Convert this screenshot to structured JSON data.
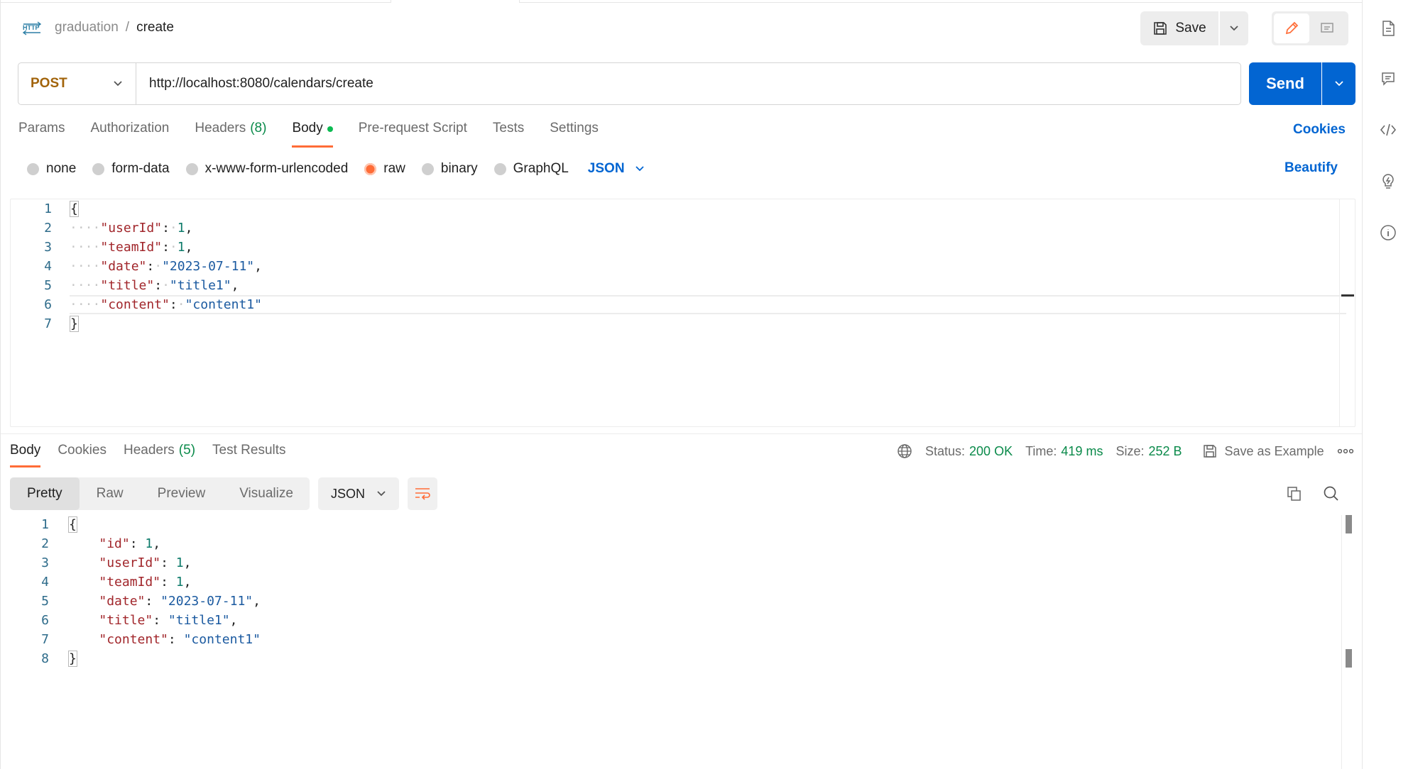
{
  "header": {
    "collection": "graduation",
    "separator": "/",
    "request_name": "create",
    "save_label": "Save"
  },
  "request": {
    "method": "POST",
    "url": "http://localhost:8080/calendars/create",
    "send_label": "Send"
  },
  "request_tabs": [
    {
      "label": "Params"
    },
    {
      "label": "Authorization"
    },
    {
      "label": "Headers",
      "count": "(8)"
    },
    {
      "label": "Body",
      "active": true
    },
    {
      "label": "Pre-request Script"
    },
    {
      "label": "Tests"
    },
    {
      "label": "Settings"
    }
  ],
  "cookies_label": "Cookies",
  "body_types": [
    {
      "label": "none"
    },
    {
      "label": "form-data"
    },
    {
      "label": "x-www-form-urlencoded"
    },
    {
      "label": "raw",
      "checked": true
    },
    {
      "label": "binary"
    },
    {
      "label": "GraphQL"
    }
  ],
  "body_language": "JSON",
  "beautify_label": "Beautify",
  "request_body": {
    "line_numbers": [
      "1",
      "2",
      "3",
      "4",
      "5",
      "6",
      "7"
    ],
    "lines": [
      {
        "parts": [
          {
            "t": "{",
            "c": "brace"
          }
        ]
      },
      {
        "parts": [
          {
            "t": "····",
            "c": "ws"
          },
          {
            "t": "\"userId\"",
            "c": "k"
          },
          {
            "t": ":",
            "c": ""
          },
          {
            "t": "·",
            "c": "ws"
          },
          {
            "t": "1",
            "c": "n"
          },
          {
            "t": ",",
            "c": ""
          }
        ]
      },
      {
        "parts": [
          {
            "t": "····",
            "c": "ws"
          },
          {
            "t": "\"teamId\"",
            "c": "k"
          },
          {
            "t": ":",
            "c": ""
          },
          {
            "t": "·",
            "c": "ws"
          },
          {
            "t": "1",
            "c": "n"
          },
          {
            "t": ",",
            "c": ""
          }
        ]
      },
      {
        "parts": [
          {
            "t": "····",
            "c": "ws"
          },
          {
            "t": "\"date\"",
            "c": "k"
          },
          {
            "t": ":",
            "c": ""
          },
          {
            "t": "·",
            "c": "ws"
          },
          {
            "t": "\"2023-07-11\"",
            "c": "s"
          },
          {
            "t": ",",
            "c": ""
          }
        ]
      },
      {
        "parts": [
          {
            "t": "····",
            "c": "ws"
          },
          {
            "t": "\"title\"",
            "c": "k"
          },
          {
            "t": ":",
            "c": ""
          },
          {
            "t": "·",
            "c": "ws"
          },
          {
            "t": "\"title1\"",
            "c": "s"
          },
          {
            "t": ",",
            "c": ""
          }
        ]
      },
      {
        "parts": [
          {
            "t": "····",
            "c": "ws"
          },
          {
            "t": "\"content\"",
            "c": "k"
          },
          {
            "t": ":",
            "c": ""
          },
          {
            "t": "·",
            "c": "ws"
          },
          {
            "t": "\"content1\"",
            "c": "s"
          }
        ]
      },
      {
        "parts": [
          {
            "t": "}",
            "c": "brace"
          }
        ]
      }
    ]
  },
  "response_tabs": [
    {
      "label": "Body",
      "active": true
    },
    {
      "label": "Cookies"
    },
    {
      "label": "Headers",
      "count": "(5)"
    },
    {
      "label": "Test Results"
    }
  ],
  "response_meta": {
    "status_label": "Status:",
    "status_value": "200 OK",
    "time_label": "Time:",
    "time_value": "419 ms",
    "size_label": "Size:",
    "size_value": "252 B",
    "save_example_label": "Save as Example"
  },
  "response_views": [
    {
      "label": "Pretty",
      "active": true
    },
    {
      "label": "Raw"
    },
    {
      "label": "Preview"
    },
    {
      "label": "Visualize"
    }
  ],
  "response_language": "JSON",
  "response_body": {
    "line_numbers": [
      "1",
      "2",
      "3",
      "4",
      "5",
      "6",
      "7",
      "8"
    ],
    "lines": [
      {
        "parts": [
          {
            "t": "{",
            "c": "brace"
          }
        ]
      },
      {
        "parts": [
          {
            "t": "    ",
            "c": ""
          },
          {
            "t": "\"id\"",
            "c": "k"
          },
          {
            "t": ": ",
            "c": ""
          },
          {
            "t": "1",
            "c": "n"
          },
          {
            "t": ",",
            "c": ""
          }
        ]
      },
      {
        "parts": [
          {
            "t": "    ",
            "c": ""
          },
          {
            "t": "\"userId\"",
            "c": "k"
          },
          {
            "t": ": ",
            "c": ""
          },
          {
            "t": "1",
            "c": "n"
          },
          {
            "t": ",",
            "c": ""
          }
        ]
      },
      {
        "parts": [
          {
            "t": "    ",
            "c": ""
          },
          {
            "t": "\"teamId\"",
            "c": "k"
          },
          {
            "t": ": ",
            "c": ""
          },
          {
            "t": "1",
            "c": "n"
          },
          {
            "t": ",",
            "c": ""
          }
        ]
      },
      {
        "parts": [
          {
            "t": "    ",
            "c": ""
          },
          {
            "t": "\"date\"",
            "c": "k"
          },
          {
            "t": ": ",
            "c": ""
          },
          {
            "t": "\"2023-07-11\"",
            "c": "s"
          },
          {
            "t": ",",
            "c": ""
          }
        ]
      },
      {
        "parts": [
          {
            "t": "    ",
            "c": ""
          },
          {
            "t": "\"title\"",
            "c": "k"
          },
          {
            "t": ": ",
            "c": ""
          },
          {
            "t": "\"title1\"",
            "c": "s"
          },
          {
            "t": ",",
            "c": ""
          }
        ]
      },
      {
        "parts": [
          {
            "t": "    ",
            "c": ""
          },
          {
            "t": "\"content\"",
            "c": "k"
          },
          {
            "t": ": ",
            "c": ""
          },
          {
            "t": "\"content1\"",
            "c": "s"
          }
        ]
      },
      {
        "parts": [
          {
            "t": "}",
            "c": "brace"
          }
        ]
      }
    ]
  },
  "right_sidebar_icons": [
    "documentation-icon",
    "comments-icon",
    "code-icon",
    "lightbulb-icon",
    "info-icon"
  ],
  "colors": {
    "accent": "#ff6c37",
    "primary": "#0265d2",
    "success": "#0a8a4a",
    "method_post": "#a2640b"
  }
}
